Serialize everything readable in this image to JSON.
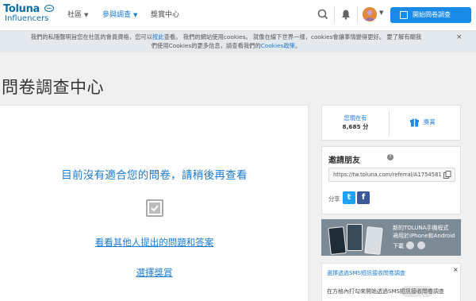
{
  "header": {
    "logo_top": "Toluna",
    "logo_bottom": "Influencers",
    "nav": [
      {
        "label": "社區",
        "active": false
      },
      {
        "label": "參與調查",
        "active": true
      },
      {
        "label": "獎賞中心",
        "active": false
      }
    ],
    "cta_label": "開始問卷調查",
    "icons": [
      "search-icon",
      "bell-icon",
      "avatar",
      "survey-icon"
    ]
  },
  "cookie": {
    "text_a": "我們的私隱聲明旨您在社區的會員資格，您可以",
    "link1": "按此",
    "text_b": "查看。 我們的網站使用cookies。 就像在線下世界一樣，cookies會讓事情變得更好。 要了解有關我",
    "text_c": "們使用Cookies的更多信息，請查看我們的",
    "link2": "Cookies政策",
    "text_d": "。",
    "close": "×"
  },
  "page": {
    "title": "問卷調查中心"
  },
  "main": {
    "empty_message": "目前沒有適合您的問卷，請稍後再查看",
    "link_questions": "看看其他人提出的問題和答案",
    "link_rewards": "選擇獎賞"
  },
  "points": {
    "label": "您現在有",
    "value": "8,685 分",
    "reward_label": "獎賞"
  },
  "invite": {
    "title": "邀請朋友",
    "help": "?",
    "referral_url": "https://tw.toluna.com/referral/A1754581",
    "share_label": "分享",
    "twitter": "t",
    "facebook": "f"
  },
  "app": {
    "line1": "新的TOLUNA手機程式",
    "line2": "適用於iPhone和Android",
    "download": "下載"
  },
  "sms": {
    "title": "選擇透過SMS短訊接收問卷調查",
    "close": "×",
    "text": "在方格內打勾來開始透過SMS短訊接收問卷調查"
  },
  "colors": {
    "accent": "#1a7ad4",
    "cta": "#1a8ae8",
    "cookie_bg": "#e4e9ee",
    "page_bg": "#f0f0f0"
  }
}
